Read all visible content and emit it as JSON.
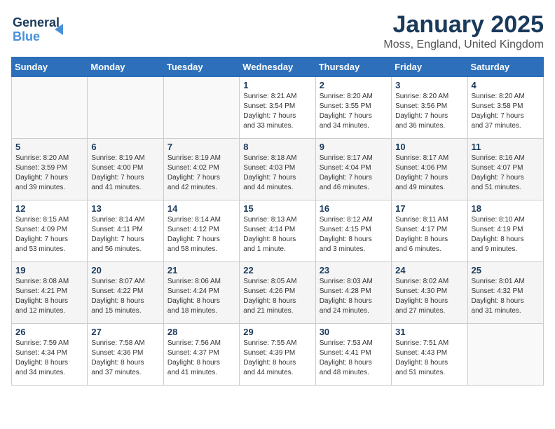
{
  "logo": {
    "line1": "General",
    "line2": "Blue"
  },
  "title": "January 2025",
  "subtitle": "Moss, England, United Kingdom",
  "weekdays": [
    "Sunday",
    "Monday",
    "Tuesday",
    "Wednesday",
    "Thursday",
    "Friday",
    "Saturday"
  ],
  "weeks": [
    [
      {
        "num": "",
        "info": ""
      },
      {
        "num": "",
        "info": ""
      },
      {
        "num": "",
        "info": ""
      },
      {
        "num": "1",
        "info": "Sunrise: 8:21 AM\nSunset: 3:54 PM\nDaylight: 7 hours\nand 33 minutes."
      },
      {
        "num": "2",
        "info": "Sunrise: 8:20 AM\nSunset: 3:55 PM\nDaylight: 7 hours\nand 34 minutes."
      },
      {
        "num": "3",
        "info": "Sunrise: 8:20 AM\nSunset: 3:56 PM\nDaylight: 7 hours\nand 36 minutes."
      },
      {
        "num": "4",
        "info": "Sunrise: 8:20 AM\nSunset: 3:58 PM\nDaylight: 7 hours\nand 37 minutes."
      }
    ],
    [
      {
        "num": "5",
        "info": "Sunrise: 8:20 AM\nSunset: 3:59 PM\nDaylight: 7 hours\nand 39 minutes."
      },
      {
        "num": "6",
        "info": "Sunrise: 8:19 AM\nSunset: 4:00 PM\nDaylight: 7 hours\nand 41 minutes."
      },
      {
        "num": "7",
        "info": "Sunrise: 8:19 AM\nSunset: 4:02 PM\nDaylight: 7 hours\nand 42 minutes."
      },
      {
        "num": "8",
        "info": "Sunrise: 8:18 AM\nSunset: 4:03 PM\nDaylight: 7 hours\nand 44 minutes."
      },
      {
        "num": "9",
        "info": "Sunrise: 8:17 AM\nSunset: 4:04 PM\nDaylight: 7 hours\nand 46 minutes."
      },
      {
        "num": "10",
        "info": "Sunrise: 8:17 AM\nSunset: 4:06 PM\nDaylight: 7 hours\nand 49 minutes."
      },
      {
        "num": "11",
        "info": "Sunrise: 8:16 AM\nSunset: 4:07 PM\nDaylight: 7 hours\nand 51 minutes."
      }
    ],
    [
      {
        "num": "12",
        "info": "Sunrise: 8:15 AM\nSunset: 4:09 PM\nDaylight: 7 hours\nand 53 minutes."
      },
      {
        "num": "13",
        "info": "Sunrise: 8:14 AM\nSunset: 4:11 PM\nDaylight: 7 hours\nand 56 minutes."
      },
      {
        "num": "14",
        "info": "Sunrise: 8:14 AM\nSunset: 4:12 PM\nDaylight: 7 hours\nand 58 minutes."
      },
      {
        "num": "15",
        "info": "Sunrise: 8:13 AM\nSunset: 4:14 PM\nDaylight: 8 hours\nand 1 minute."
      },
      {
        "num": "16",
        "info": "Sunrise: 8:12 AM\nSunset: 4:15 PM\nDaylight: 8 hours\nand 3 minutes."
      },
      {
        "num": "17",
        "info": "Sunrise: 8:11 AM\nSunset: 4:17 PM\nDaylight: 8 hours\nand 6 minutes."
      },
      {
        "num": "18",
        "info": "Sunrise: 8:10 AM\nSunset: 4:19 PM\nDaylight: 8 hours\nand 9 minutes."
      }
    ],
    [
      {
        "num": "19",
        "info": "Sunrise: 8:08 AM\nSunset: 4:21 PM\nDaylight: 8 hours\nand 12 minutes."
      },
      {
        "num": "20",
        "info": "Sunrise: 8:07 AM\nSunset: 4:22 PM\nDaylight: 8 hours\nand 15 minutes."
      },
      {
        "num": "21",
        "info": "Sunrise: 8:06 AM\nSunset: 4:24 PM\nDaylight: 8 hours\nand 18 minutes."
      },
      {
        "num": "22",
        "info": "Sunrise: 8:05 AM\nSunset: 4:26 PM\nDaylight: 8 hours\nand 21 minutes."
      },
      {
        "num": "23",
        "info": "Sunrise: 8:03 AM\nSunset: 4:28 PM\nDaylight: 8 hours\nand 24 minutes."
      },
      {
        "num": "24",
        "info": "Sunrise: 8:02 AM\nSunset: 4:30 PM\nDaylight: 8 hours\nand 27 minutes."
      },
      {
        "num": "25",
        "info": "Sunrise: 8:01 AM\nSunset: 4:32 PM\nDaylight: 8 hours\nand 31 minutes."
      }
    ],
    [
      {
        "num": "26",
        "info": "Sunrise: 7:59 AM\nSunset: 4:34 PM\nDaylight: 8 hours\nand 34 minutes."
      },
      {
        "num": "27",
        "info": "Sunrise: 7:58 AM\nSunset: 4:36 PM\nDaylight: 8 hours\nand 37 minutes."
      },
      {
        "num": "28",
        "info": "Sunrise: 7:56 AM\nSunset: 4:37 PM\nDaylight: 8 hours\nand 41 minutes."
      },
      {
        "num": "29",
        "info": "Sunrise: 7:55 AM\nSunset: 4:39 PM\nDaylight: 8 hours\nand 44 minutes."
      },
      {
        "num": "30",
        "info": "Sunrise: 7:53 AM\nSunset: 4:41 PM\nDaylight: 8 hours\nand 48 minutes."
      },
      {
        "num": "31",
        "info": "Sunrise: 7:51 AM\nSunset: 4:43 PM\nDaylight: 8 hours\nand 51 minutes."
      },
      {
        "num": "",
        "info": ""
      }
    ]
  ]
}
